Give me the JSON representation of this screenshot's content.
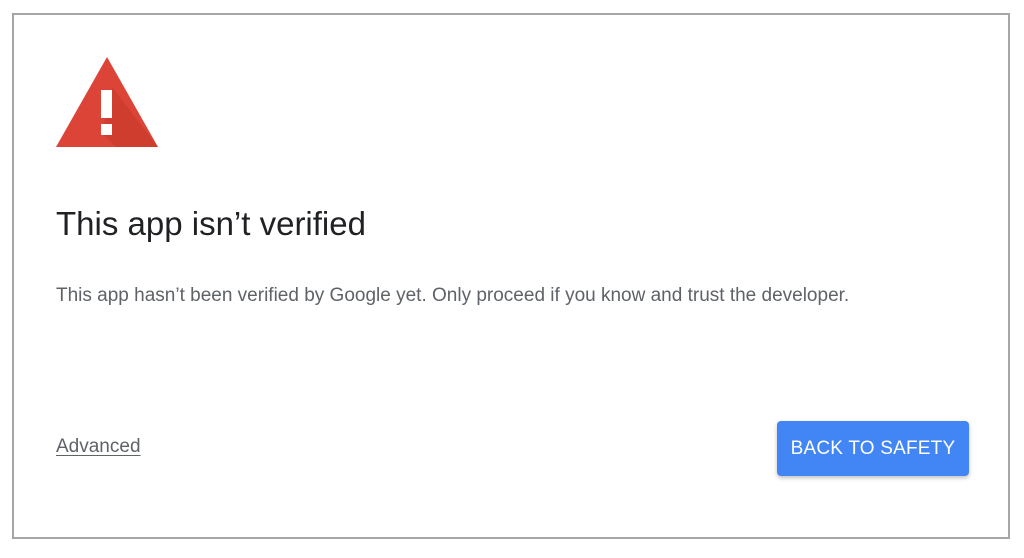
{
  "dialog": {
    "icon": "warning-triangle-icon",
    "title": "This app isn’t verified",
    "message": "This app hasn’t been verified by Google yet. Only proceed if you know and trust the developer.",
    "advanced_link": "Advanced",
    "back_to_safety_button": "BACK TO SAFETY"
  },
  "colors": {
    "warning_red": "#db4437",
    "accent_blue": "#4285f4",
    "title_text": "#202124",
    "body_text": "#5f6368",
    "border": "#a6a6a6"
  }
}
